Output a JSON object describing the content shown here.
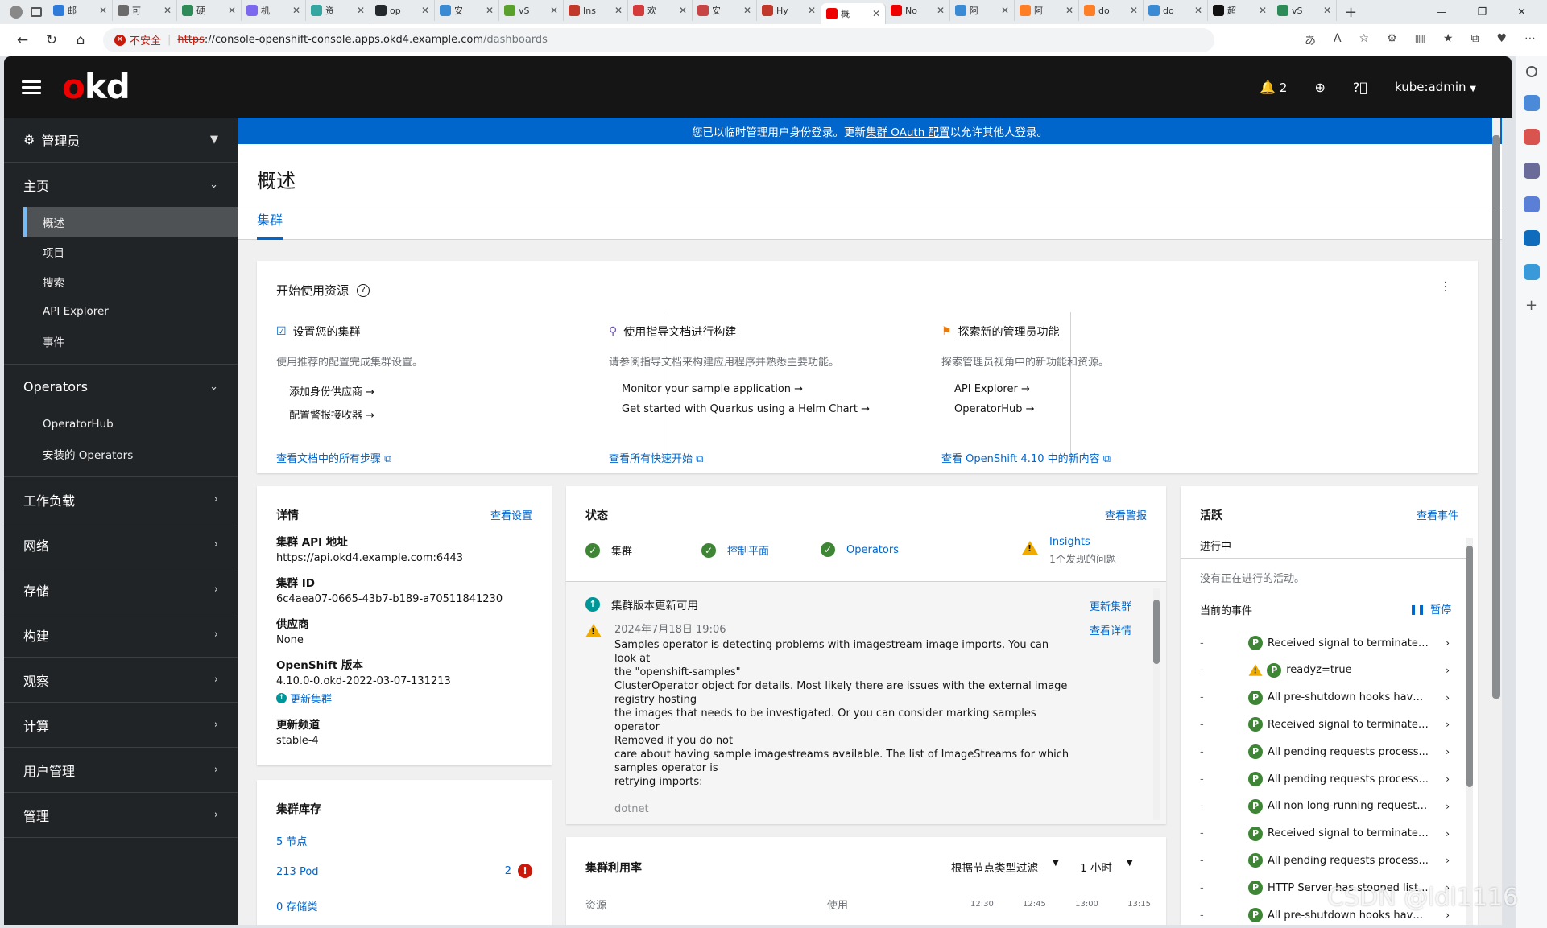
{
  "browser": {
    "tabs": [
      {
        "label": "邮",
        "color": "#2f7bd9"
      },
      {
        "label": "可",
        "color": "#6b6b6b"
      },
      {
        "label": "硬",
        "color": "#2e8b57"
      },
      {
        "label": "机",
        "color": "#7b68ee"
      },
      {
        "label": "资",
        "color": "#35a7a0"
      },
      {
        "label": "op",
        "color": "#24292e"
      },
      {
        "label": "安",
        "color": "#3b8bd4"
      },
      {
        "label": "vS",
        "color": "#5aa02c"
      },
      {
        "label": "Ins",
        "color": "#c0392b"
      },
      {
        "label": "欢",
        "color": "#d63b3b"
      },
      {
        "label": "安",
        "color": "#c74545"
      },
      {
        "label": "Hy",
        "color": "#c0392b"
      },
      {
        "label": "概",
        "color": "#ee0000"
      },
      {
        "label": "No",
        "color": "#ee0000"
      },
      {
        "label": "阿",
        "color": "#3b8bd4"
      },
      {
        "label": "阿",
        "color": "#ff7f27"
      },
      {
        "label": "do",
        "color": "#ff7f27"
      },
      {
        "label": "do",
        "color": "#3b8bd4"
      },
      {
        "label": "超",
        "color": "#111111"
      },
      {
        "label": "vS",
        "color": "#2e8b57"
      }
    ],
    "active_tab_index": 12,
    "insecure_label": "不安全",
    "url_scheme": "https",
    "url_host": "://console-openshift-console.apps.okd4.example.com",
    "url_path": "/dashboards"
  },
  "masthead": {
    "logo_o": "o",
    "logo_rest": "kd",
    "notifications": "2",
    "user": "kube:admin"
  },
  "sidebar": {
    "perspective": "管理员",
    "home": {
      "label": "主页",
      "items": [
        "概述",
        "项目",
        "搜索",
        "API Explorer",
        "事件"
      ]
    },
    "operators": {
      "label": "Operators",
      "items": [
        "OperatorHub",
        "安装的 Operators"
      ]
    },
    "sections": [
      "工作负载",
      "网络",
      "存储",
      "构建",
      "观察",
      "计算",
      "用户管理",
      "管理"
    ]
  },
  "banner": {
    "prefix": "您已以临时管理用户身份登录。更新",
    "link": "集群 OAuth 配置",
    "suffix": "以允许其他人登录。"
  },
  "page": {
    "title": "概述",
    "tab": "集群"
  },
  "getting_started": {
    "title": "开始使用资源",
    "columns": [
      {
        "heading": "设置您的集群",
        "desc": "使用推荐的配置完成集群设置。",
        "links": [
          "添加身份供应商",
          "配置警报接收器"
        ],
        "footer": "查看文档中的所有步骤"
      },
      {
        "heading": "使用指导文档进行构建",
        "desc": "请参阅指导文档来构建应用程序并熟悉主要功能。",
        "links": [
          "Monitor your sample application",
          "Get started with Quarkus using a Helm Chart"
        ],
        "footer": "查看所有快速开始"
      },
      {
        "heading": "探索新的管理员功能",
        "desc": "探索管理员视角中的新功能和资源。",
        "links": [
          "API Explorer",
          "OperatorHub"
        ],
        "footer": "查看 OpenShift 4.10 中的新内容"
      }
    ]
  },
  "details": {
    "title": "详情",
    "action": "查看设置",
    "fields": [
      {
        "label": "集群 API 地址",
        "value": "https://api.okd4.example.com:6443"
      },
      {
        "label": "集群 ID",
        "value": "6c4aea07-0665-43b7-b189-a70511841230"
      },
      {
        "label": "供应商",
        "value": "None"
      },
      {
        "label": "OpenShift 版本",
        "value": "4.10.0-0.okd-2022-03-07-131213"
      }
    ],
    "update_link": "更新集群",
    "channel_label": "更新频道",
    "channel_value": "stable-4"
  },
  "inventory": {
    "title": "集群库存",
    "nodes": "5 节点",
    "pods": "213 Pod",
    "pod_errors": "2",
    "storage": "0 存储类"
  },
  "status": {
    "title": "状态",
    "action": "查看警报",
    "items": [
      {
        "label": "集群"
      },
      {
        "label": "控制平面"
      },
      {
        "label": "Operators"
      }
    ],
    "insights_label": "Insights",
    "insights_sub": "1个发现的问题",
    "update_title": "集群版本更新可用",
    "update_action": "更新集群",
    "alert_time": "2024年7月18日 19:06",
    "alert_action": "查看详情",
    "alert_lines": [
      "Samples operator is detecting problems with imagestream image imports. You can look at",
      "the \"openshift-samples\"",
      "ClusterOperator object for details. Most likely there are issues with the external image",
      "registry hosting",
      "the images that needs to be investigated. Or you can consider marking samples operator",
      "Removed if you do not",
      "care about having sample imagestreams available. The list of ImageStreams for which",
      "samples operator is",
      "retrying imports:",
      "",
      "dotnet"
    ]
  },
  "utilization": {
    "title": "集群利用率",
    "filter": "根据节点类型过滤",
    "range": "1 小时",
    "col_resource": "资源",
    "col_usage": "使用",
    "times": [
      "12:30",
      "12:45",
      "13:00",
      "13:15"
    ]
  },
  "activity": {
    "title": "活跃",
    "action": "查看事件",
    "ongoing_label": "进行中",
    "ongoing_empty": "没有正在进行的活动。",
    "recent_label": "当前的事件",
    "pause": "暂停",
    "events": [
      {
        "text": "Received signal to terminate, ...",
        "warn": false
      },
      {
        "text": "readyz=true",
        "warn": true
      },
      {
        "text": "All pre-shutdown hooks have ...",
        "warn": false
      },
      {
        "text": "Received signal to terminate, ...",
        "warn": false
      },
      {
        "text": "All pending requests process...",
        "warn": false
      },
      {
        "text": "All pending requests process...",
        "warn": false
      },
      {
        "text": "All non long-running request(...",
        "warn": false
      },
      {
        "text": "Received signal to terminate, ...",
        "warn": false
      },
      {
        "text": "All pending requests process...",
        "warn": false
      },
      {
        "text": "HTTP Server has stopped list...",
        "warn": false
      },
      {
        "text": "All pre-shutdown hooks have ...",
        "warn": false
      }
    ],
    "badge_letter": "P",
    "dash": "-"
  },
  "watermark": "CSDN @ldl1116",
  "colors": {
    "masthead": "#151515",
    "sidebar": "#212427",
    "link": "#0066cc",
    "banner": "#0066cc",
    "success": "#3e8635",
    "warning": "#f0ab00",
    "danger": "#c9190b"
  }
}
